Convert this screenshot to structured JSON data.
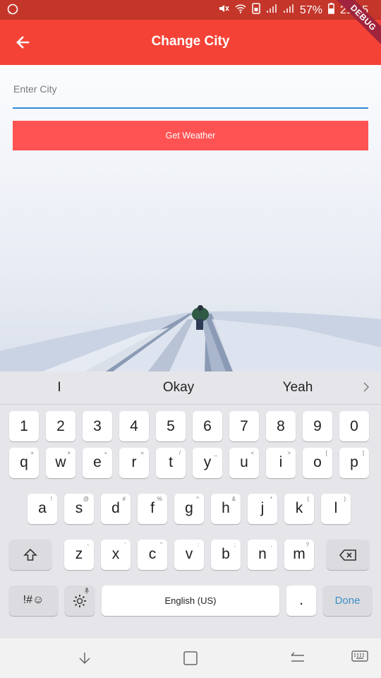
{
  "status_bar": {
    "battery": "57%",
    "time": "21:45"
  },
  "debug_banner": "DEBUG",
  "app_bar": {
    "title": "Change City"
  },
  "form": {
    "city_placeholder": "Enter City",
    "submit_label": "Get Weather"
  },
  "suggestions": [
    "I",
    "Okay",
    "Yeah"
  ],
  "keyboard": {
    "row1": [
      [
        "1",
        ""
      ],
      [
        "2",
        ""
      ],
      [
        "3",
        ""
      ],
      [
        "4",
        ""
      ],
      [
        "5",
        ""
      ],
      [
        "6",
        ""
      ],
      [
        "7",
        ""
      ],
      [
        "8",
        ""
      ],
      [
        "9",
        ""
      ],
      [
        "0",
        ""
      ]
    ],
    "row2": [
      [
        "q",
        "+"
      ],
      [
        "w",
        "×"
      ],
      [
        "e",
        "÷"
      ],
      [
        "r",
        "="
      ],
      [
        "t",
        "/"
      ],
      [
        "y",
        "_"
      ],
      [
        "u",
        "<"
      ],
      [
        "i",
        ">"
      ],
      [
        "o",
        "["
      ],
      [
        "p",
        "]"
      ]
    ],
    "row3": [
      [
        "a",
        "!"
      ],
      [
        "s",
        "@"
      ],
      [
        "d",
        "#"
      ],
      [
        "f",
        "%"
      ],
      [
        "g",
        "^"
      ],
      [
        "h",
        "&"
      ],
      [
        "j",
        "*"
      ],
      [
        "k",
        "("
      ],
      [
        "l",
        ")"
      ]
    ],
    "row4": [
      [
        "z",
        "-"
      ],
      [
        "x",
        "'"
      ],
      [
        "c",
        "\""
      ],
      [
        "v",
        ":"
      ],
      [
        "b",
        ";"
      ],
      [
        "n",
        ","
      ],
      [
        "m",
        "?"
      ]
    ],
    "symbols_label": "!#☺",
    "space_label": "English (US)",
    "period_label": ".",
    "done_label": "Done"
  },
  "colors": {
    "app_bar": "#f44336",
    "status_bar": "#c4362a",
    "button": "#ff5252",
    "field_focus": "#2b8ad9"
  }
}
